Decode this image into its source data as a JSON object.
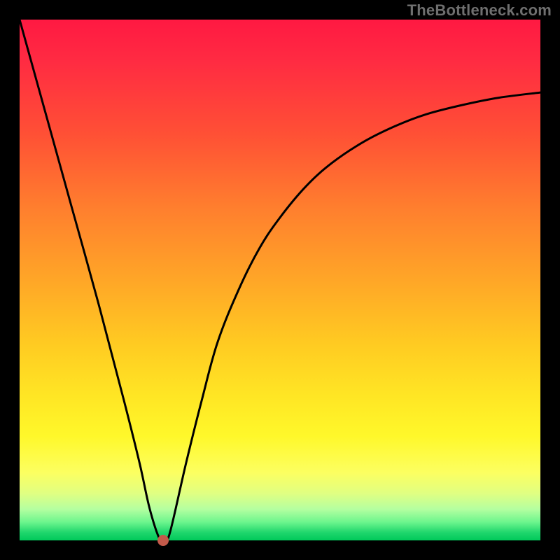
{
  "watermark": "TheBottleneck.com",
  "chart_data": {
    "type": "line",
    "title": "",
    "xlabel": "",
    "ylabel": "",
    "xlim": [
      0,
      100
    ],
    "ylim": [
      0,
      100
    ],
    "series": [
      {
        "name": "curve",
        "x": [
          0,
          5,
          10,
          15,
          20,
          23,
          25,
          27,
          28,
          29,
          32,
          35,
          38,
          42,
          46,
          50,
          55,
          60,
          66,
          72,
          78,
          85,
          92,
          100
        ],
        "y": [
          100,
          82,
          64,
          46,
          27,
          15,
          6,
          0,
          0,
          2,
          15,
          27,
          38,
          48,
          56,
          62,
          68,
          72.5,
          76.5,
          79.5,
          81.8,
          83.6,
          85.0,
          86.0
        ]
      }
    ],
    "marker": {
      "x": 27.5,
      "y": 0,
      "color": "#c35a4a"
    },
    "gradient_stops": [
      {
        "pos": 0,
        "color": "#ff1942"
      },
      {
        "pos": 0.5,
        "color": "#ffa627"
      },
      {
        "pos": 0.8,
        "color": "#fff82a"
      },
      {
        "pos": 1.0,
        "color": "#00c95a"
      }
    ]
  }
}
